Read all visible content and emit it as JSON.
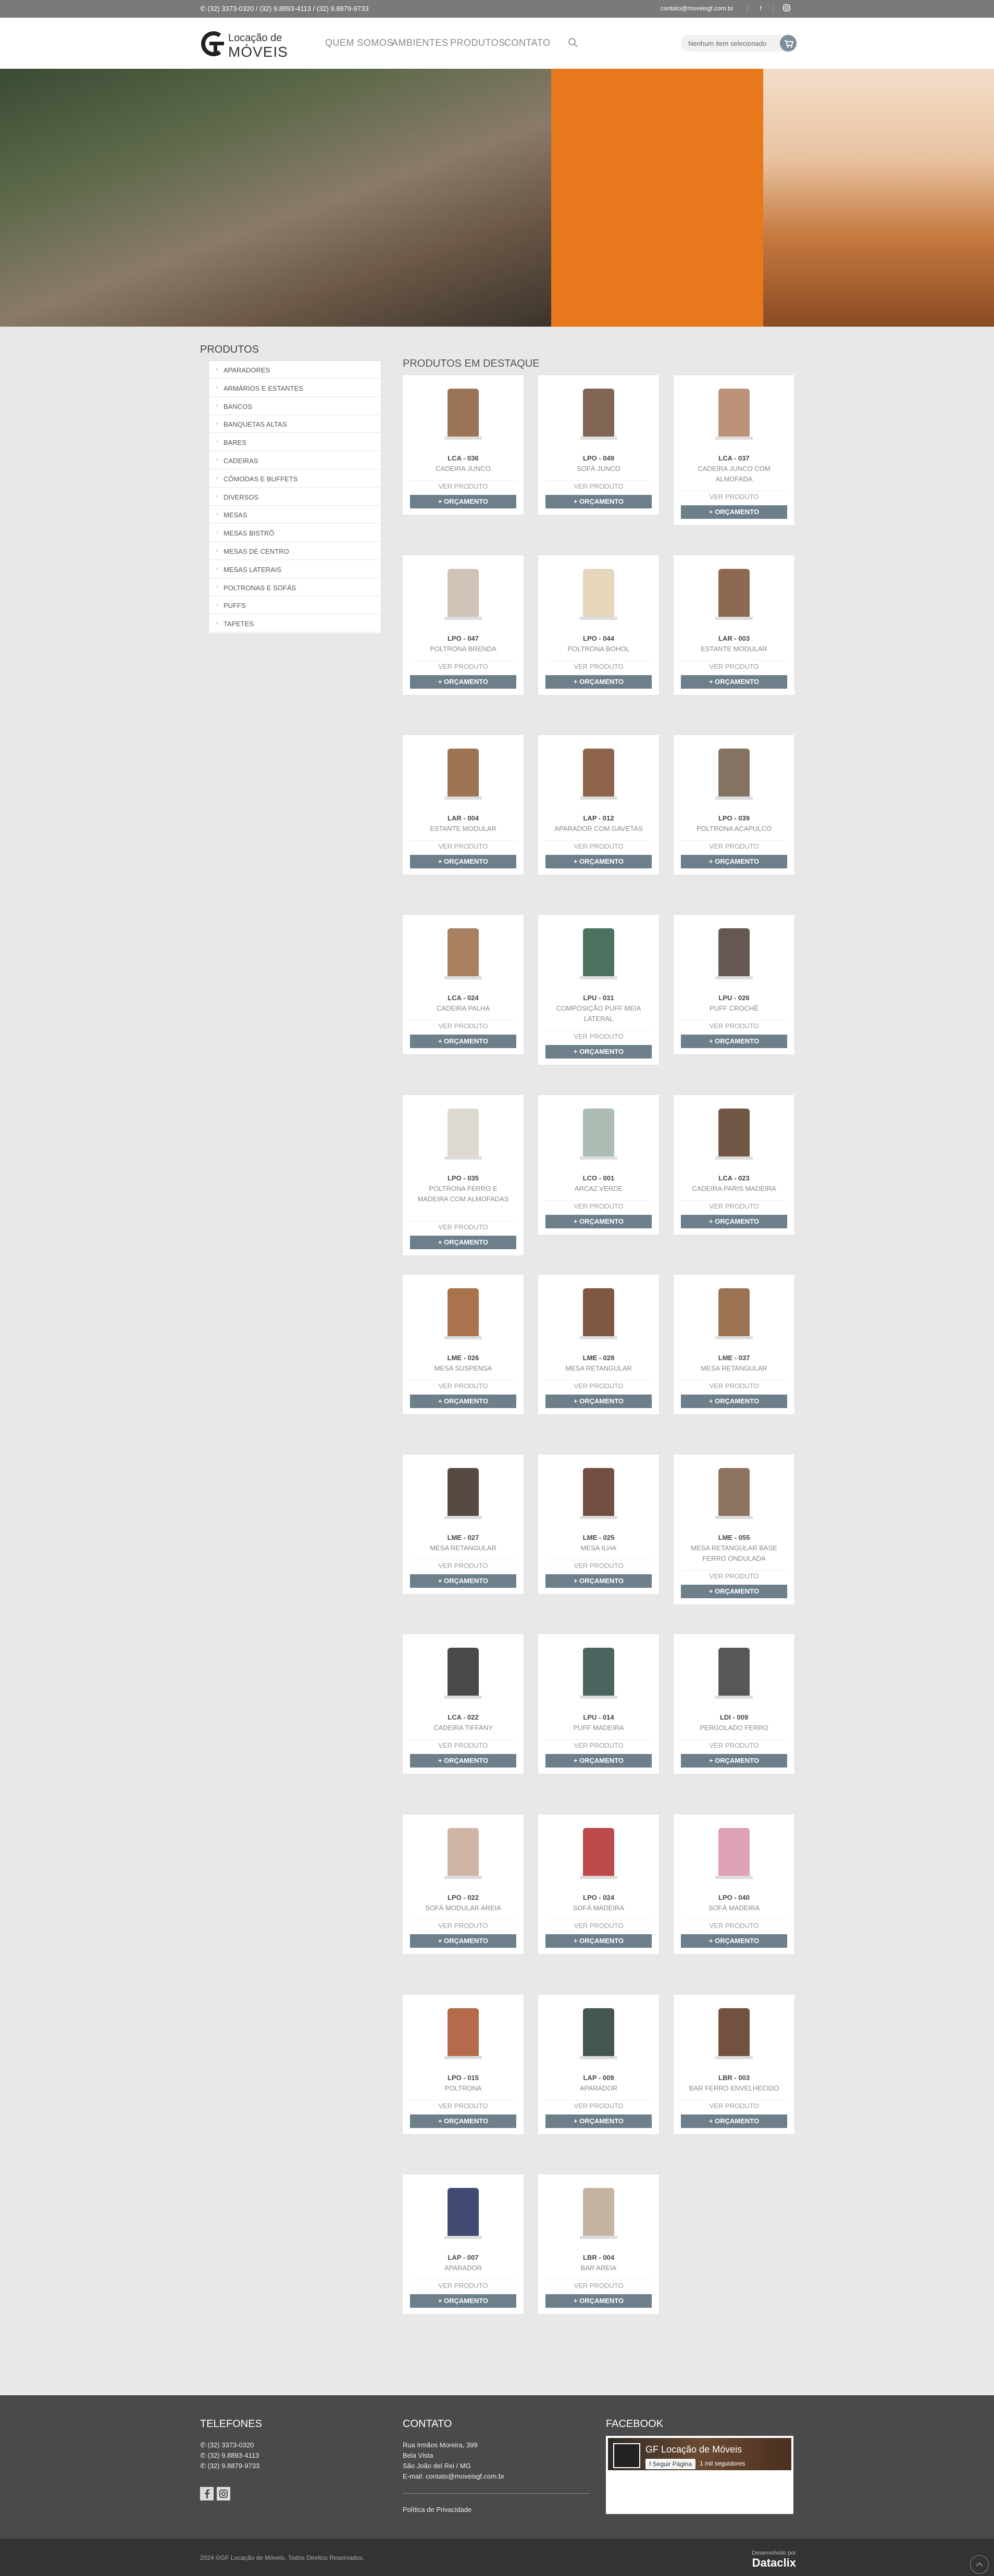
{
  "topbar": {
    "phones": "(32) 3373-0320 / (32) 9.8893-4113 / (32) 9.8879-9733",
    "email": "contato@moveisgf.com.br"
  },
  "header": {
    "logo_line1": "Locação de",
    "logo_line2": "MÓVEIS",
    "nav": [
      "QUEM SOMOS",
      "AMBIENTES",
      "PRODUTOS",
      "CONTATO"
    ],
    "cart_text": "Nenhum item selecionado"
  },
  "sidebar": {
    "title": "PRODUTOS",
    "items": [
      "APARADORES",
      "ARMÁRIOS E ESTANTES",
      "BANCOS",
      "BANQUETAS ALTAS",
      "BARES",
      "CADEIRAS",
      "CÔMODAS E BUFFETS",
      "DIVERSOS",
      "MESAS",
      "MESAS BISTRÔ",
      "MESAS DE CENTRO",
      "MESAS LATERAIS",
      "POLTRONAS E SOFÁS",
      "PUFFS",
      "TAPETES"
    ]
  },
  "main": {
    "title": "PRODUTOS EM DESTAQUE",
    "view_label": "VER PRODUTO",
    "quote_label": "ORÇAMENTO",
    "products": [
      {
        "code": "LCA - 036",
        "name": "CADEIRA JUNCO"
      },
      {
        "code": "LPO - 049",
        "name": "SOFÁ JUNCO"
      },
      {
        "code": "LCA - 037",
        "name": "CADEIRA JUNCO COM ALMOFADA"
      },
      {
        "code": "LPO - 047",
        "name": "POLTRONA BRENDA"
      },
      {
        "code": "LPO - 044",
        "name": "POLTRONA BOHOL"
      },
      {
        "code": "LAR - 003",
        "name": "ESTANTE MODULAR"
      },
      {
        "code": "LAR - 004",
        "name": "ESTANTE MODULAR"
      },
      {
        "code": "LAP - 012",
        "name": "APARADOR COM GAVETAS"
      },
      {
        "code": "LPO - 039",
        "name": "POLTRONA ACAPULCO"
      },
      {
        "code": "LCA - 024",
        "name": "CADEIRA PALHA"
      },
      {
        "code": "LPU - 031",
        "name": "COMPOSIÇÃO PUFF MEIA LATERAL"
      },
      {
        "code": "LPU - 026",
        "name": "PUFF CROCHÊ"
      },
      {
        "code": "LPO - 035",
        "name": "POLTRONA FERRO E MADEIRA COM ALMOFADAS"
      },
      {
        "code": "LCO - 001",
        "name": "ARCAZ VERDE"
      },
      {
        "code": "LCA - 023",
        "name": "CADEIRA PARIS MADEIRA"
      },
      {
        "code": "LME - 026",
        "name": "MESA SUSPENSA"
      },
      {
        "code": "LME - 028",
        "name": "MESA RETANGULAR"
      },
      {
        "code": "LME - 037",
        "name": "MESA RETANGULAR"
      },
      {
        "code": "LME - 027",
        "name": "MESA RETANGULAR"
      },
      {
        "code": "LME - 025",
        "name": "MESA ILHA"
      },
      {
        "code": "LME - 055",
        "name": "MESA RETANGULAR BASE FERRO ONDULADA"
      },
      {
        "code": "LCA - 022",
        "name": "CADEIRA TIFFANY"
      },
      {
        "code": "LPU - 014",
        "name": "PUFF MADEIRA"
      },
      {
        "code": "LDI - 009",
        "name": "PERGOLADO FERRO"
      },
      {
        "code": "LPO - 022",
        "name": "SOFÁ MODULAR AREIA"
      },
      {
        "code": "LPO - 024",
        "name": "SOFÁ MADEIRA"
      },
      {
        "code": "LPO - 040",
        "name": "SOFÁ MADEIRA"
      },
      {
        "code": "LPO - 015",
        "name": "POLTRONA"
      },
      {
        "code": "LAP - 009",
        "name": "APARADOR"
      },
      {
        "code": "LBR - 003",
        "name": "BAR FERRO ENVELHECIDO"
      },
      {
        "code": "LAP - 007",
        "name": "APARADOR"
      },
      {
        "code": "LBR - 004",
        "name": "BAR AREIA"
      }
    ]
  },
  "footer": {
    "phones_title": "TELEFONES",
    "phones": [
      "(32) 3373-0320",
      "(32) 9.8893-4113",
      "(32) 9.8879-9733"
    ],
    "contact_title": "CONTATO",
    "address": [
      "Rua Irmãos Moreira, 399",
      "Bela Vista",
      "São João del Rei / MG",
      "E-mail: contato@moveisgf.com.br"
    ],
    "privacy": "Política de Privacidade",
    "facebook_title": "FACEBOOK",
    "fb_page": "GF Locação de Móveis",
    "fb_follow": "Seguir Página",
    "fb_likes": "1 mil seguidores",
    "copyright": "2024 ©GF Locação de Móveis. Todos Direitos Reservados.",
    "dev_label": "Desenvolvido por",
    "dev_name": "Dataclix"
  }
}
